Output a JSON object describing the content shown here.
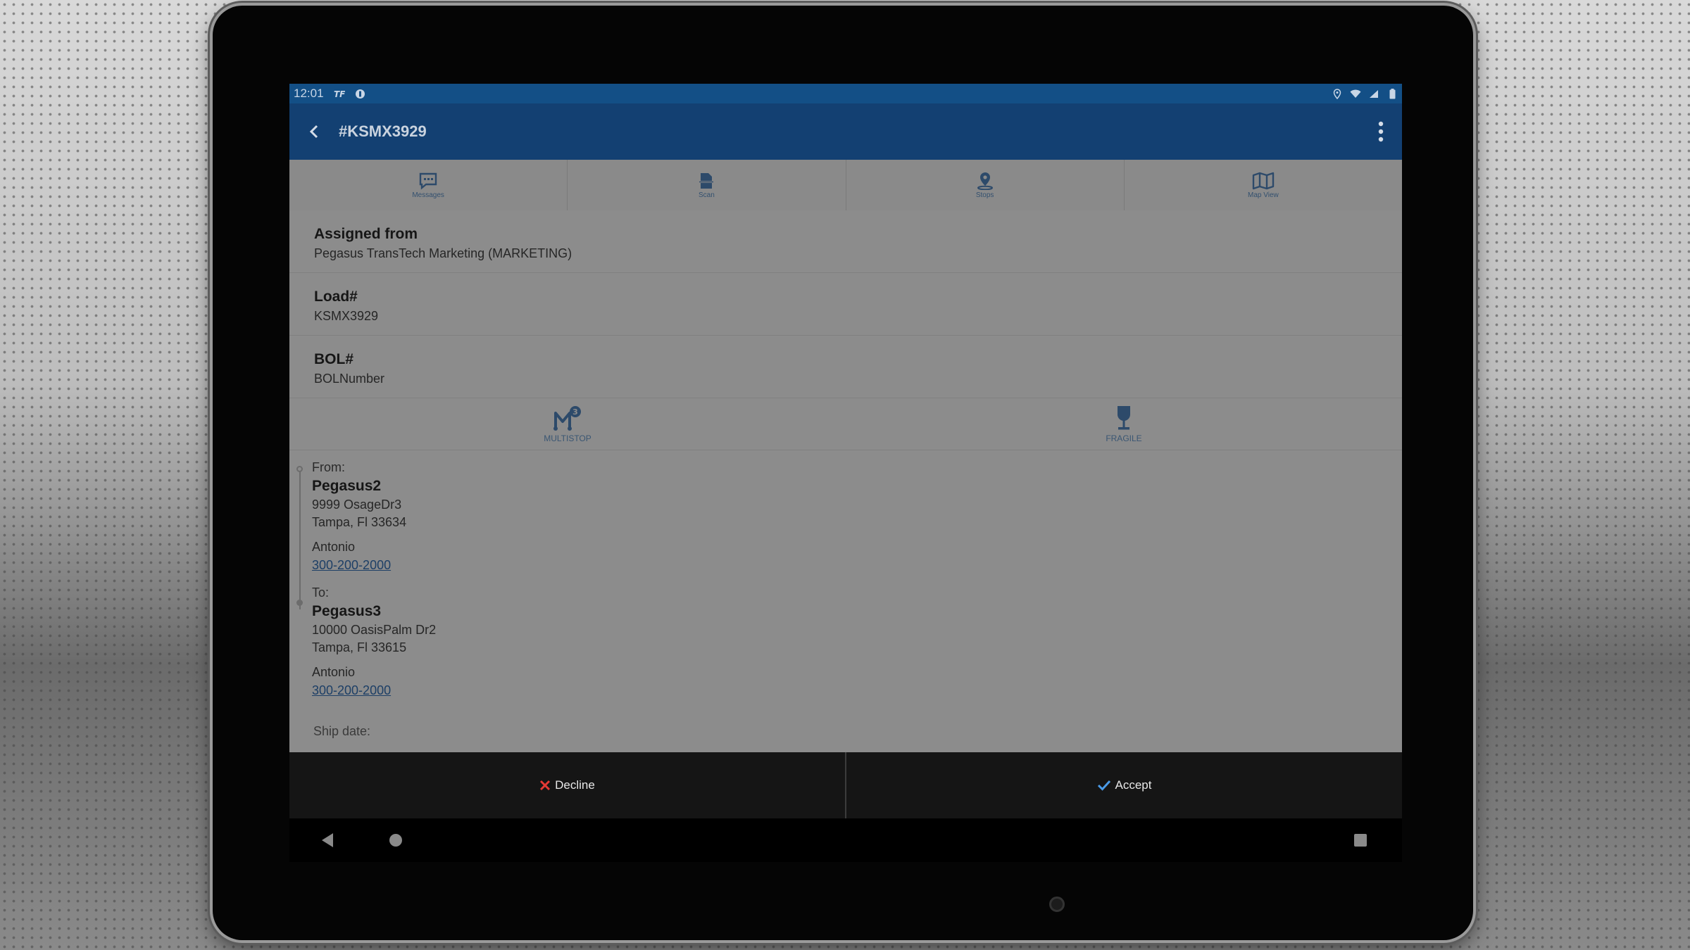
{
  "status_bar": {
    "time": "12:01"
  },
  "app_bar": {
    "title": "#KSMX3929"
  },
  "tabs": [
    {
      "label": "Messages",
      "icon": "message-icon"
    },
    {
      "label": "Scan",
      "icon": "scan-icon"
    },
    {
      "label": "Stops",
      "icon": "location-pin-icon"
    },
    {
      "label": "Map View",
      "icon": "map-icon"
    }
  ],
  "fields": [
    {
      "label": "Assigned from",
      "value": "Pegasus TransTech Marketing (MARKETING)"
    },
    {
      "label": "Load#",
      "value": "KSMX3929"
    },
    {
      "label": "BOL#",
      "value": "BOLNumber"
    }
  ],
  "badges": [
    {
      "label": "MULTISTOP",
      "icon": "multistop-icon",
      "count": "3"
    },
    {
      "label": "FRAGILE",
      "icon": "fragile-icon"
    }
  ],
  "route": {
    "from": {
      "tag": "From:",
      "name": "Pegasus2",
      "address1": "9999 OsageDr3",
      "address2": "Tampa, Fl 33634",
      "contact": "Antonio",
      "phone": "300-200-2000"
    },
    "to": {
      "tag": "To:",
      "name": "Pegasus3",
      "address1": "10000 OasisPalm Dr2",
      "address2": "Tampa, Fl 33615",
      "contact": "Antonio",
      "phone": "300-200-2000"
    },
    "ship_date_label": "Ship date:"
  },
  "actions": {
    "decline": "Decline",
    "accept": "Accept"
  },
  "colors": {
    "status_bar": "#134f86",
    "app_bar": "#134072",
    "accent_blue": "#2d4a6a",
    "decline_red": "#e53935",
    "accept_blue": "#4a9be8"
  }
}
